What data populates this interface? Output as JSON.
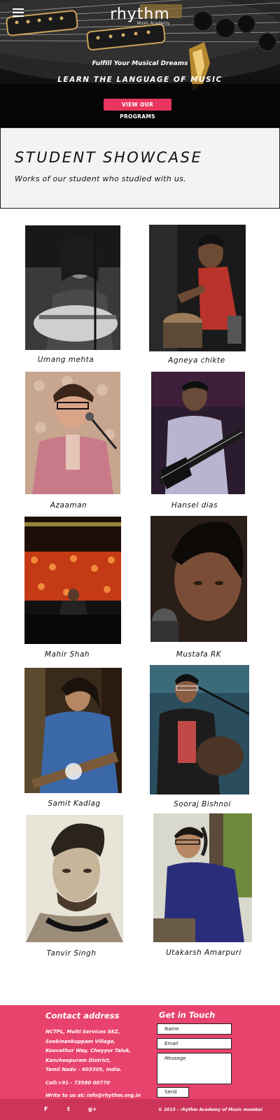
{
  "header": {
    "logo_word": "rhythm",
    "logo_sub": "Music Academy",
    "tagline": "Fulfill Your Musical Dreams",
    "headline": "LEARN THE LANGUAGE OF MUSIC",
    "cta_label": "VIEW OUR PROGRAMS",
    "menu_icon": "hamburger-menu-icon"
  },
  "showcase": {
    "title": "STUDENT SHOWCASE",
    "subtitle": "Works of our student who studied with us."
  },
  "students": [
    {
      "name": "Umang mehta"
    },
    {
      "name": "Agneya chikte"
    },
    {
      "name": "Azaaman"
    },
    {
      "name": "Hansel dias"
    },
    {
      "name": "Mahir Shah"
    },
    {
      "name": "Mustafa RK"
    },
    {
      "name": "Samit Kadlag"
    },
    {
      "name": "Sooraj Bishnoi"
    },
    {
      "name": "Tanvir Singh"
    },
    {
      "name": "Utakarsh Amarpuri"
    }
  ],
  "footer": {
    "contact_heading": "Contact address",
    "address_lines": [
      "NCTPL, Multi Services SEZ,",
      "Seekinankuppam Village,",
      "Koovathur Way, Cheyyur Taluk,",
      "Kancheepuram District,",
      "Tamil Nadu – 603305, India."
    ],
    "phone": "Call:+91 - 73580 00770",
    "email_line": "Write to us at: info@rhythm.org.in",
    "form_heading": "Get in Touch",
    "form": {
      "name_placeholder": "Name",
      "email_placeholder": "Email",
      "message_placeholder": "Messege",
      "send_label": "Send"
    },
    "social": [
      "F",
      "t",
      "g+"
    ],
    "copyright": "© 2015 – rhythm Academy of Music mumbai"
  },
  "colors": {
    "accent": "#e8365f",
    "footer_bg": "#e8436c",
    "footer_bar": "#cc3559"
  }
}
